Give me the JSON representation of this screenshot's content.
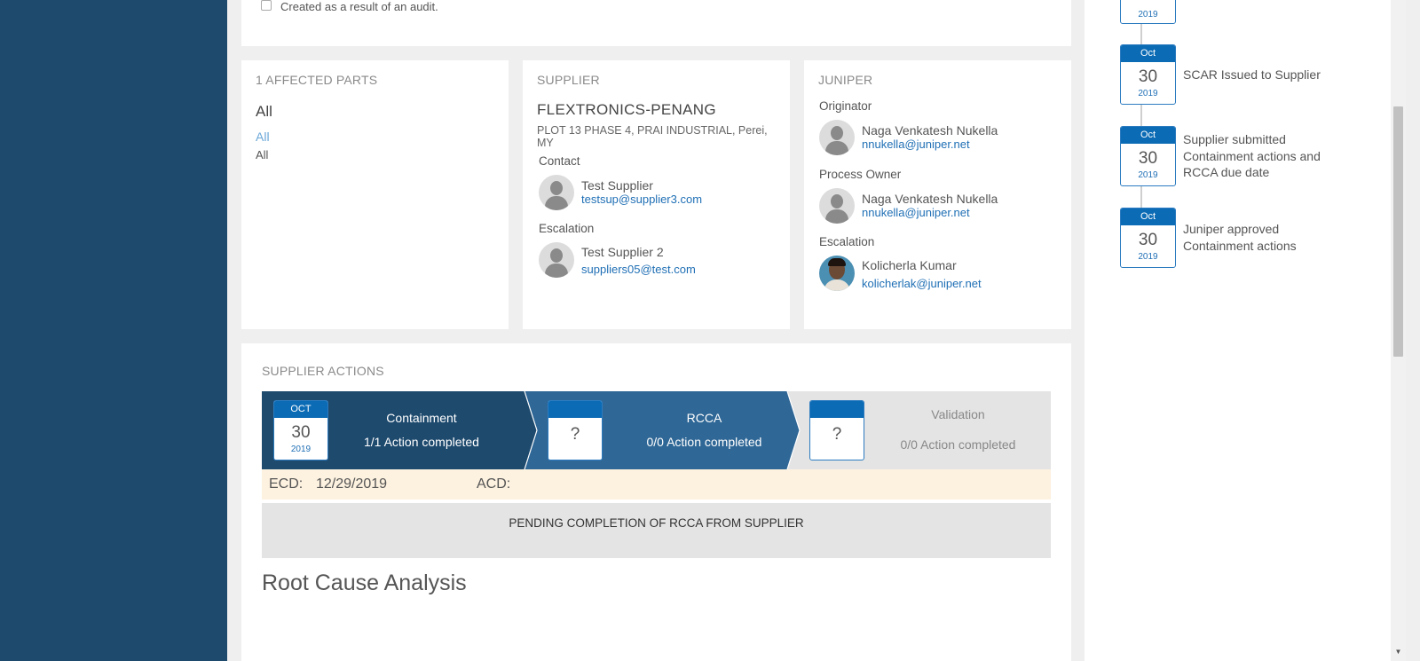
{
  "audit": {
    "label": "Created as a result of an audit."
  },
  "parts": {
    "title": "1 AFFECTED PARTS",
    "value": "All",
    "link": "All",
    "sub": "All"
  },
  "supplier": {
    "title": "SUPPLIER",
    "name": "FLEXTRONICS-PENANG",
    "address": "PLOT 13 PHASE 4, PRAI INDUSTRIAL, Perei, MY",
    "contact_label": "Contact",
    "contact": {
      "name": "Test Supplier",
      "email": "testsup@supplier3.com"
    },
    "escalation_label": "Escalation",
    "escalation": {
      "name": "Test Supplier 2",
      "email": "suppliers05@test.com"
    }
  },
  "juniper": {
    "title": "JUNIPER",
    "originator_label": "Originator",
    "originator": {
      "name": "Naga Venkatesh Nukella",
      "email": "nnukella@juniper.net"
    },
    "owner_label": "Process Owner",
    "owner": {
      "name": "Naga Venkatesh Nukella",
      "email": "nnukella@juniper.net"
    },
    "escalation_label": "Escalation",
    "escalation": {
      "name": "Kolicherla Kumar",
      "email": "kolicherlak@juniper.net"
    }
  },
  "actions": {
    "title": "SUPPLIER ACTIONS",
    "steps": [
      {
        "month": "OCT",
        "day": "30",
        "year": "2019",
        "title": "Containment",
        "status": "1/1 Action completed"
      },
      {
        "placeholder": "?",
        "title": "RCCA",
        "status": "0/0 Action completed"
      },
      {
        "placeholder": "?",
        "title": "Validation",
        "status": "0/0 Action completed"
      }
    ],
    "ecd_label": "ECD:",
    "ecd_value": "12/29/2019",
    "acd_label": "ACD:",
    "acd_value": "",
    "pending": "PENDING COMPLETION OF RCCA FROM SUPPLIER"
  },
  "rca": {
    "title": "Root Cause Analysis"
  },
  "timeline": [
    {
      "month": "",
      "day": "",
      "year": "2019",
      "text": ""
    },
    {
      "month": "Oct",
      "day": "30",
      "year": "2019",
      "text": "SCAR Issued to Supplier"
    },
    {
      "month": "Oct",
      "day": "30",
      "year": "2019",
      "text": "Supplier submitted Containment actions and RCCA due date"
    },
    {
      "month": "Oct",
      "day": "30",
      "year": "2019",
      "text": "Juniper approved Containment actions"
    }
  ],
  "colors": {
    "nav": "#1e4a6e",
    "step_dark": "#1e4a6e",
    "step_mid": "#2f6796",
    "calendar_header": "#0b6bb5",
    "link": "#1f6fb5",
    "ecd_bg": "#fdf1df"
  }
}
